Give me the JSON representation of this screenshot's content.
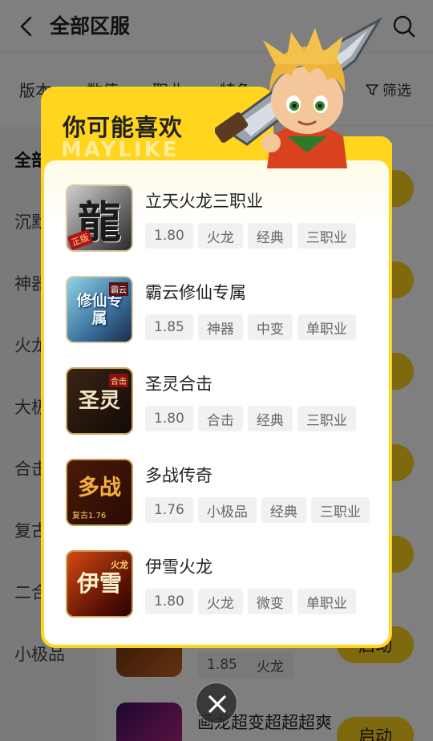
{
  "header": {
    "title": "全部区服"
  },
  "filters": {
    "items": [
      "版本",
      "数值",
      "职业",
      "特色"
    ],
    "screen_label": "筛选"
  },
  "sidebar": {
    "items": [
      "全部",
      "沉默",
      "神器",
      "火龙",
      "大极",
      "合击",
      "复古",
      "二合",
      "小极品"
    ]
  },
  "background_list": {
    "rows": [
      {
        "name": "",
        "tags": [
          "1.85",
          "火龙"
        ],
        "button": "启动"
      },
      {
        "name": "画龙超变超超超爽",
        "tags": [],
        "button": "启动"
      }
    ]
  },
  "modal": {
    "title": "你可能喜欢",
    "watermark": "MAYLIKE",
    "items": [
      {
        "name": "立天火龙三职业",
        "tags": [
          "1.80",
          "火龙",
          "经典",
          "三职业"
        ],
        "icon_text": "龍",
        "icon_sub": "正版"
      },
      {
        "name": "霸云修仙专属",
        "tags": [
          "1.85",
          "神器",
          "中变",
          "单职业"
        ],
        "icon_text": "修仙专属",
        "icon_sub": "霸云"
      },
      {
        "name": "圣灵合击",
        "tags": [
          "1.80",
          "合击",
          "经典",
          "三职业"
        ],
        "icon_text": "圣灵",
        "icon_sub": "合击"
      },
      {
        "name": "多战传奇",
        "tags": [
          "1.76",
          "小极品",
          "经典",
          "三职业"
        ],
        "icon_text": "多战",
        "icon_sub": "复古1.76"
      },
      {
        "name": "伊雪火龙",
        "tags": [
          "1.80",
          "火龙",
          "微变",
          "单职业"
        ],
        "icon_text": "伊雪",
        "icon_sub": "火龙"
      }
    ]
  },
  "colors": {
    "accent": "#ffd51e",
    "overlay": "rgba(0,0,0,0.5)"
  },
  "icons": {
    "back": "chevron-left-icon",
    "search": "search-icon",
    "filter": "filter-icon",
    "close": "close-icon"
  }
}
